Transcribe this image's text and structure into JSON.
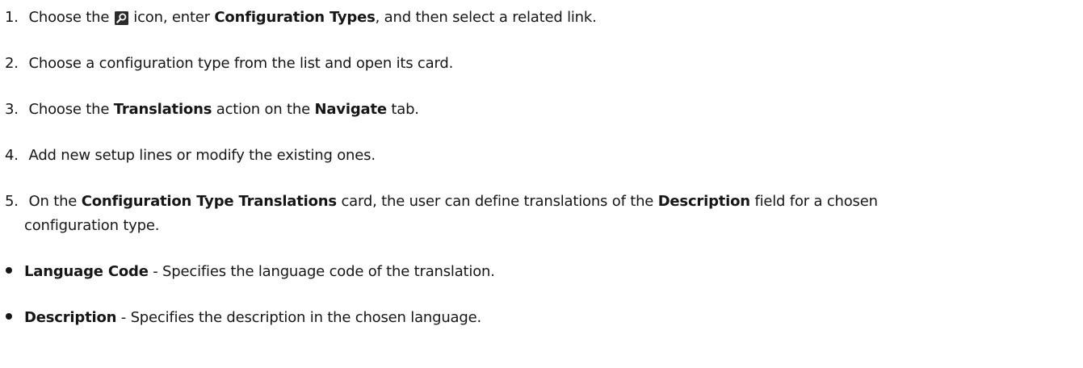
{
  "steps": [
    {
      "number": "1.",
      "text_a": "Choose the",
      "icon": "search-icon",
      "text_b": " icon, enter ",
      "bold_a": "Configuration Types",
      "text_c": ", and then select a related link."
    },
    {
      "number": "2.",
      "text_a": "Choose a configuration type from the list and open its card."
    },
    {
      "number": "3.",
      "text_a": "Choose the ",
      "bold_a": "Translations",
      "text_b": " action on the ",
      "bold_b": "Navigate",
      "text_c": " tab."
    },
    {
      "number": "4.",
      "text_a": "Add new setup lines or modify the existing ones."
    },
    {
      "number": "5.",
      "text_a": "On the ",
      "bold_a": "Configuration Type Translations",
      "text_b": " card, the user can define translations of the ",
      "bold_b": "Description",
      "text_c": " field for a chosen",
      "text_d": "configuration type."
    }
  ],
  "bullets": [
    {
      "term": "Language Code",
      "text": " - Specifies the language code of the translation."
    },
    {
      "term": "Description",
      "text": " - Specifies the description in the chosen language."
    }
  ],
  "colors": {
    "text": "#161616",
    "icon_bg": "#2b2b2b"
  }
}
